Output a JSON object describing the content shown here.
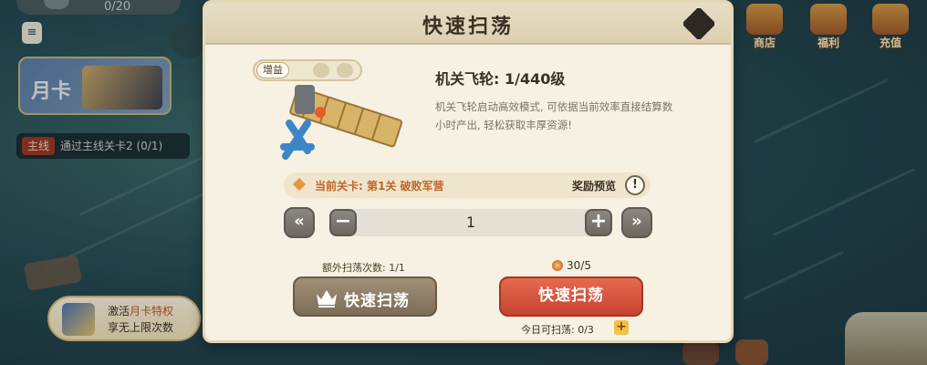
{
  "background": {
    "top_pill_text": "0/20",
    "month_card_label": "月卡",
    "quest": {
      "tag": "主线",
      "text": "通过主线关卡2 (0/1)"
    },
    "activate": {
      "line1_prefix": "激活",
      "line1_highlight": "月卡特权",
      "line2": "享无上限次数"
    },
    "right_icons": [
      {
        "icon": "shop-icon",
        "label": "商店"
      },
      {
        "icon": "welfare-icon",
        "label": "福利"
      },
      {
        "icon": "recharge-icon",
        "label": "充值"
      }
    ]
  },
  "dialog": {
    "title": "快速扫荡",
    "tag_label": "增益",
    "item_name": "机关飞轮: 1/440级",
    "item_desc": "机关飞轮启动高效模式, 可依据当前效率直接结算数小时产出, 轻松获取丰厚资源!",
    "stage_text": "当前关卡: 第1关 破败军营",
    "reward_preview": "奖励预览",
    "info_symbol": "!",
    "stepper": {
      "value": "1",
      "fast_back": "«",
      "minus": "−",
      "plus": "+",
      "fast_forward": "»"
    },
    "extra_sweeps": "额外扫荡次数: 1/1",
    "cost": "30/5",
    "vip_button_label": "快速扫荡",
    "sweep_button_label": "快速扫荡",
    "today_remaining": "今日可扫荡: 0/3",
    "add_symbol": "+"
  }
}
